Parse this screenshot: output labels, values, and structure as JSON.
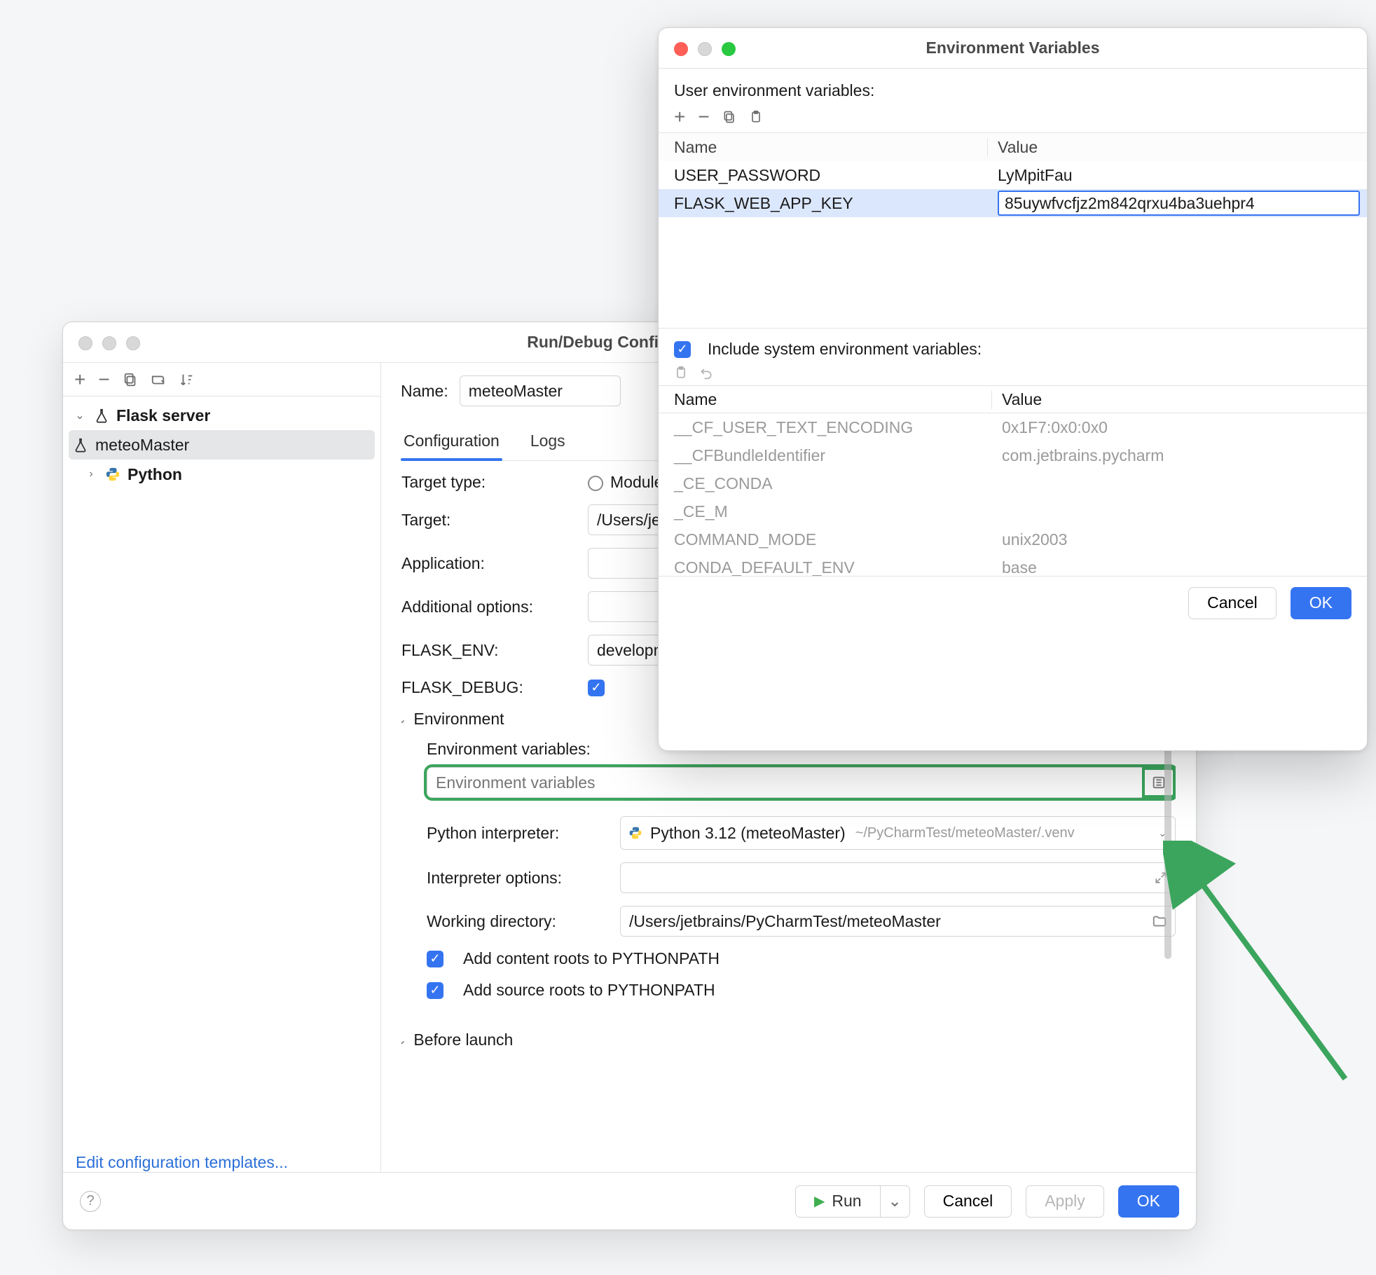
{
  "main": {
    "title": "Run/Debug Configurations",
    "name_label": "Name:",
    "name_value": "meteoMaster",
    "tabs": {
      "configuration": "Configuration",
      "logs": "Logs"
    },
    "config": {
      "target_type_label": "Target type:",
      "target_type_value": "Module name",
      "target_label": "Target:",
      "target_value": "/Users/jetbrains/PyCharmTest/meteoMaster",
      "application_label": "Application:",
      "application_value": "",
      "additional_label": "Additional options:",
      "additional_value": "",
      "flask_env_label": "FLASK_ENV:",
      "flask_env_value": "development",
      "flask_debug_label": "FLASK_DEBUG:",
      "environment_header": "Environment",
      "env_vars_label": "Environment variables:",
      "env_vars_placeholder": "Environment variables",
      "py_interp_label": "Python interpreter:",
      "py_interp_name": "Python 3.12 (meteoMaster)",
      "py_interp_path": "~/PyCharmTest/meteoMaster/.venv",
      "interp_opts_label": "Interpreter options:",
      "interp_opts_value": "",
      "workdir_label": "Working directory:",
      "workdir_value": "/Users/jetbrains/PyCharmTest/meteoMaster",
      "add_content_roots": "Add content roots to PYTHONPATH",
      "add_source_roots": "Add source roots to PYTHONPATH",
      "before_launch": "Before launch"
    },
    "sidebar": {
      "flask_server": "Flask server",
      "meteo": "meteoMaster",
      "python": "Python",
      "edit_templates": "Edit configuration templates..."
    },
    "footer": {
      "run": "Run",
      "cancel": "Cancel",
      "apply": "Apply",
      "ok": "OK"
    }
  },
  "env": {
    "title": "Environment Variables",
    "user_label": "User environment variables:",
    "cols": {
      "name": "Name",
      "value": "Value"
    },
    "rows": [
      {
        "name": "USER_PASSWORD",
        "value": "LyMpitFau"
      },
      {
        "name": "FLASK_WEB_APP_KEY",
        "value": "85uywfvcfjz2m842qrxu4ba3uehpr4"
      }
    ],
    "include_label": "Include system environment variables:",
    "sys_rows": [
      {
        "name": "__CF_USER_TEXT_ENCODING",
        "value": "0x1F7:0x0:0x0"
      },
      {
        "name": "__CFBundleIdentifier",
        "value": "com.jetbrains.pycharm"
      },
      {
        "name": "_CE_CONDA",
        "value": ""
      },
      {
        "name": "_CE_M",
        "value": ""
      },
      {
        "name": "COMMAND_MODE",
        "value": "unix2003"
      },
      {
        "name": "CONDA_DEFAULT_ENV",
        "value": "base"
      }
    ],
    "footer": {
      "cancel": "Cancel",
      "ok": "OK"
    }
  }
}
